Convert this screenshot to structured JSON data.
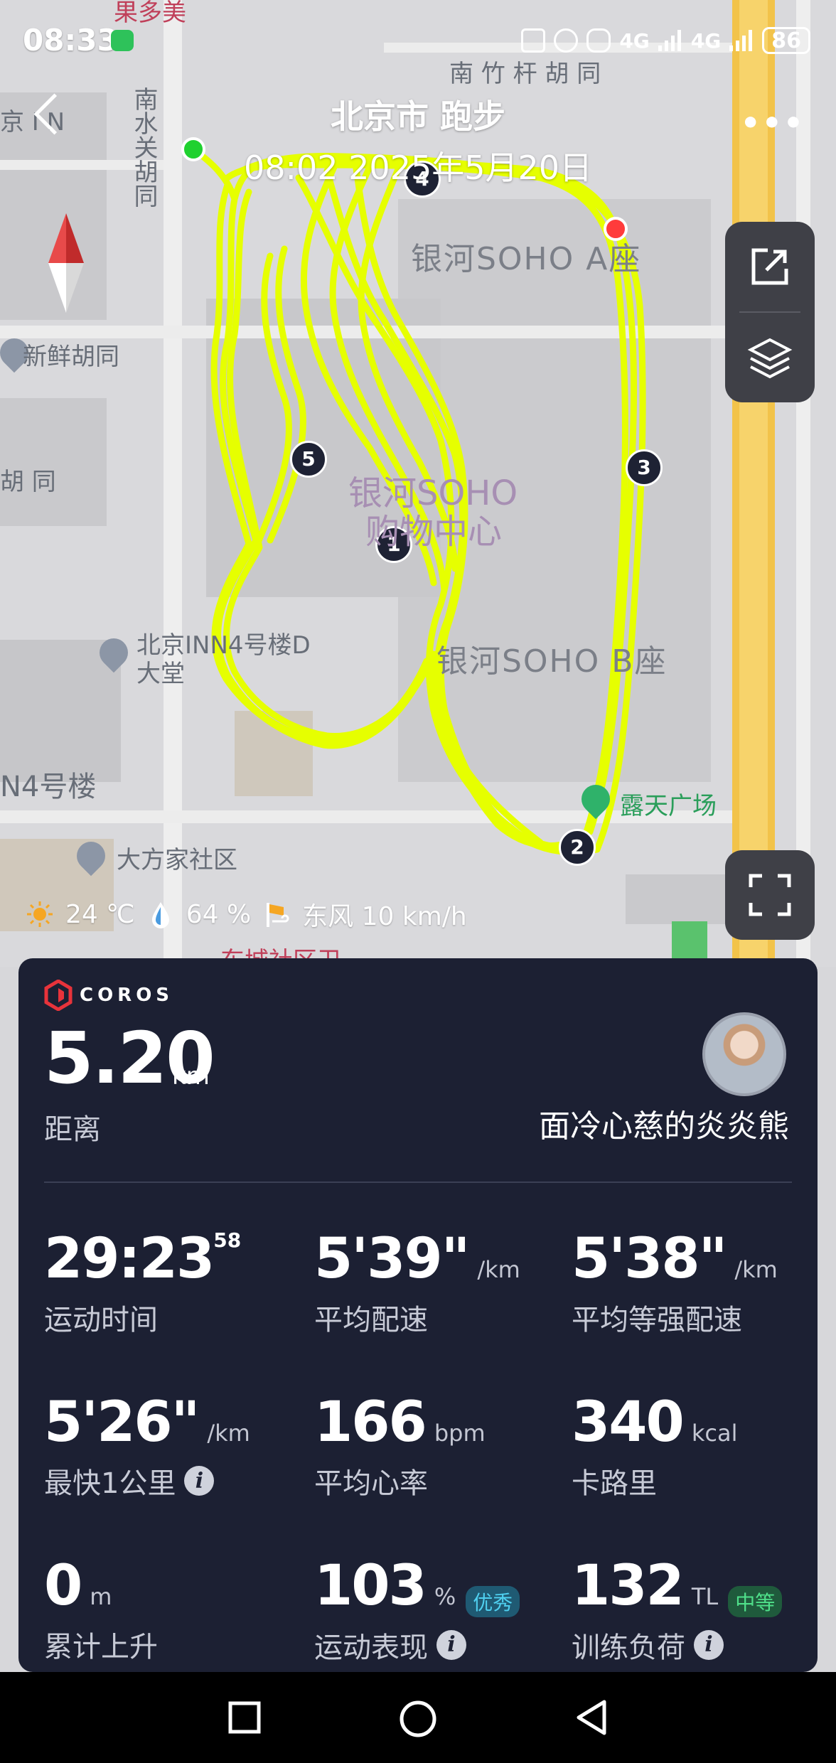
{
  "status_bar": {
    "time": "08:33",
    "network_1": "4G",
    "network_2": "4G",
    "battery": "86"
  },
  "header": {
    "title": "北京市 跑步",
    "subtitle": "08:02 2025年5月20日",
    "more": "•••"
  },
  "map": {
    "labels": {
      "top_poi": "果多美",
      "nanzhugan": "南 竹 杆 胡 同",
      "hotel_left": "京 I N",
      "nanshuiguan": "南水关胡同",
      "xinxian": "新鲜胡同",
      "hutong": "胡 同",
      "soho_a": "银河SOHO A座",
      "soho_center": "银河SOHO",
      "soho_center_2": "购物中心",
      "soho_b": "银河SOHO B座",
      "inn_hall": "北京INN4号楼D",
      "inn_hall_2": "大堂",
      "building4": "N4号楼",
      "dafangjia": "大方家社区",
      "plaza": "露天广场",
      "bottom_cut": "东城社区卫"
    },
    "markers": [
      "1",
      "2",
      "3",
      "4",
      "5"
    ],
    "route_color": "#e6ff00",
    "start_color": "#1fd12f",
    "end_color": "#ff3b3b"
  },
  "weather": {
    "temp": "24 ℃",
    "humidity": "64 %",
    "wind": "东风 10 km/h"
  },
  "card": {
    "brand": "COROS",
    "distance": "5.20",
    "distance_unit": "km",
    "distance_label": "距离",
    "username": "面冷心慈的炎炎熊",
    "stats": [
      {
        "value": "29:23",
        "sup": "58",
        "unit": "",
        "label": "运动时间"
      },
      {
        "value": "5'39\"",
        "unit": "/km",
        "label": "平均配速"
      },
      {
        "value": "5'38\"",
        "unit": "/km",
        "label": "平均等强配速"
      },
      {
        "value": "5'26\"",
        "unit": "/km",
        "label": "最快1公里"
      },
      {
        "value": "166",
        "unit": "bpm",
        "label": "平均心率"
      },
      {
        "value": "340",
        "unit": "kcal",
        "label": "卡路里"
      },
      {
        "value": "0",
        "unit": "m",
        "label": "累计上升"
      },
      {
        "value": "103",
        "unit": "%",
        "label": "运动表现",
        "badge": "优秀"
      },
      {
        "value": "132",
        "unit": "TL",
        "label": "训练负荷",
        "badge": "中等"
      }
    ],
    "info_glyph": "i"
  }
}
